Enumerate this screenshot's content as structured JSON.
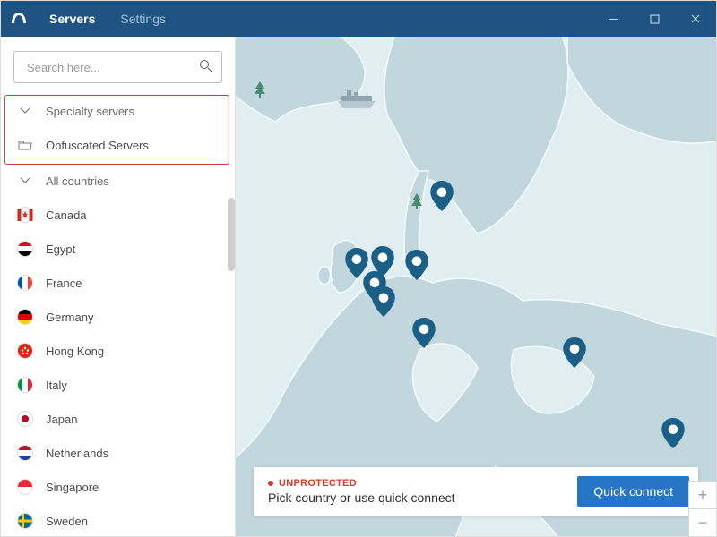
{
  "titlebar": {
    "tab_servers": "Servers",
    "tab_settings": "Settings"
  },
  "search": {
    "placeholder": "Search here..."
  },
  "specialty": {
    "header": "Specialty servers",
    "obfuscated": "Obfuscated Servers"
  },
  "all_countries_header": "All countries",
  "countries": [
    {
      "label": "Canada"
    },
    {
      "label": "Egypt"
    },
    {
      "label": "France"
    },
    {
      "label": "Germany"
    },
    {
      "label": "Hong Kong"
    },
    {
      "label": "Italy"
    },
    {
      "label": "Japan"
    },
    {
      "label": "Netherlands"
    },
    {
      "label": "Singapore"
    },
    {
      "label": "Sweden"
    }
  ],
  "status": {
    "label": "UNPROTECTED",
    "message": "Pick country or use quick connect"
  },
  "quick_connect_label": "Quick connect",
  "colors": {
    "brand_nav": "#1f5482",
    "pin": "#1b5f87",
    "map_water": "#e0eef2",
    "map_land": "#c2d6de",
    "accent_red": "#d33b2f",
    "button_blue": "#2676c5"
  }
}
